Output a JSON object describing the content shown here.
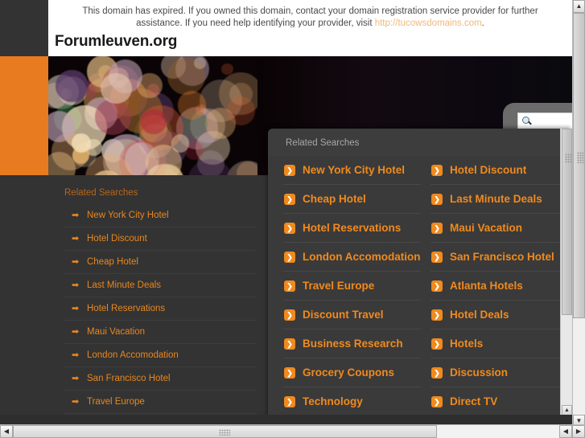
{
  "notice": {
    "text_before": "This domain has expired. If you owned this domain, contact your domain registration service provider for further assistance. If you need help identifying your provider, visit ",
    "link_text": "http://tucowsdomains.com",
    "text_after": "."
  },
  "header": {
    "site_title": "Forumleuven.org"
  },
  "hero": {
    "search_placeholder": "",
    "search_value": "",
    "search_icon": "search-icon"
  },
  "sidebar": {
    "heading": "Related Searches",
    "arrow_glyph": "➡",
    "items": [
      {
        "label": "New York City Hotel"
      },
      {
        "label": "Hotel Discount"
      },
      {
        "label": "Cheap Hotel"
      },
      {
        "label": "Last Minute Deals"
      },
      {
        "label": "Hotel Reservations"
      },
      {
        "label": "Maui Vacation"
      },
      {
        "label": "London Accomodation"
      },
      {
        "label": "San Francisco Hotel"
      },
      {
        "label": "Travel Europe"
      }
    ]
  },
  "overlay": {
    "heading": "Related Searches",
    "icon_glyph": "❯",
    "left_column": [
      {
        "label": "New York City Hotel"
      },
      {
        "label": "Cheap Hotel"
      },
      {
        "label": "Hotel Reservations"
      },
      {
        "label": "London Accomodation"
      },
      {
        "label": "Travel Europe"
      },
      {
        "label": "Discount Travel"
      },
      {
        "label": "Business Research"
      },
      {
        "label": "Grocery Coupons"
      },
      {
        "label": "Technology"
      }
    ],
    "right_column": [
      {
        "label": "Hotel Discount"
      },
      {
        "label": "Last Minute Deals"
      },
      {
        "label": "Maui Vacation"
      },
      {
        "label": "San Francisco Hotel"
      },
      {
        "label": "Atlanta Hotels"
      },
      {
        "label": "Hotel Deals"
      },
      {
        "label": "Hotels"
      },
      {
        "label": "Discussion"
      },
      {
        "label": "Direct TV"
      }
    ]
  },
  "scrollbars": {
    "up_glyph": "▲",
    "down_glyph": "▼",
    "left_glyph": "◀",
    "right_glyph": "▶"
  },
  "colors": {
    "accent_orange": "#E87B20",
    "link_orange": "#F08A1E",
    "panel_dark": "#3a3a3a",
    "page_dark": "#333333"
  }
}
